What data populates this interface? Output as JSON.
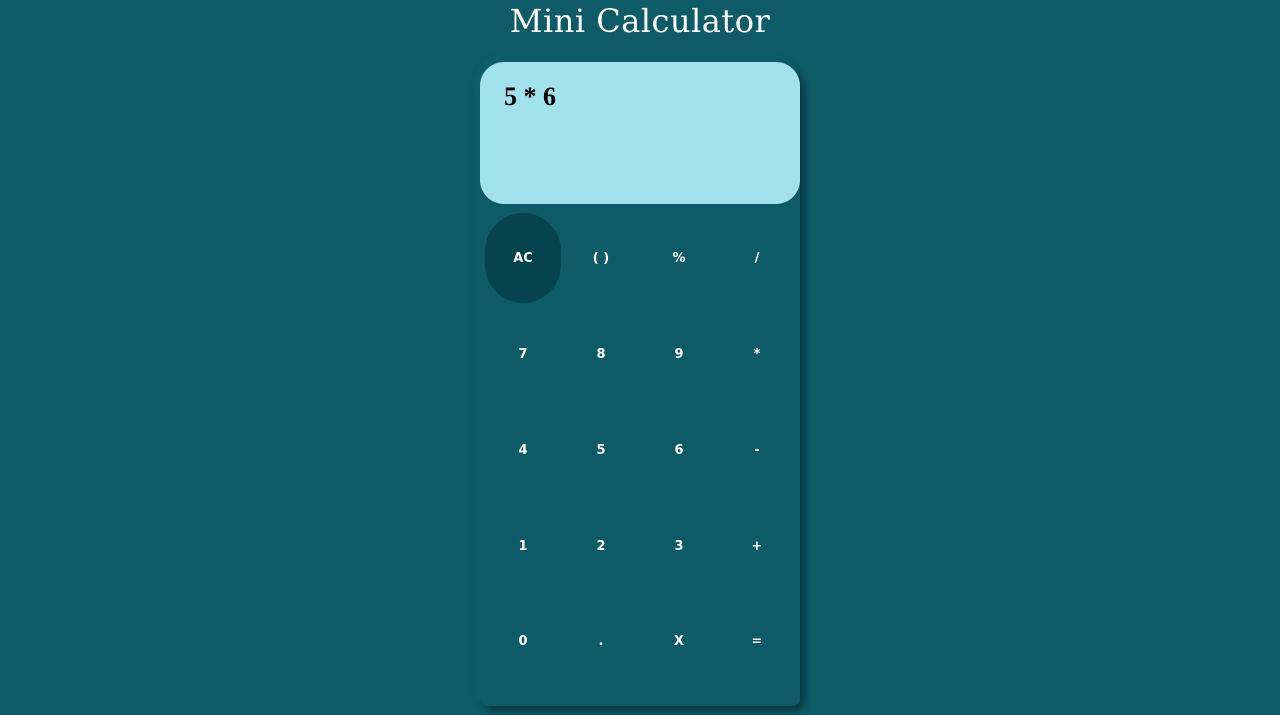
{
  "title": "Mini Calculator",
  "display": {
    "expression": "5 * 6"
  },
  "keys": [
    [
      "AC",
      "( )",
      "%",
      "/"
    ],
    [
      "7",
      "8",
      "9",
      "*"
    ],
    [
      "4",
      "5",
      "6",
      "-"
    ],
    [
      "1",
      "2",
      "3",
      "+"
    ],
    [
      "0",
      ".",
      "X",
      "="
    ]
  ],
  "colors": {
    "background": "#0e5a67",
    "display": "#a2e2ec",
    "clear_key": "#05444e",
    "key_text": "#ffffff"
  }
}
